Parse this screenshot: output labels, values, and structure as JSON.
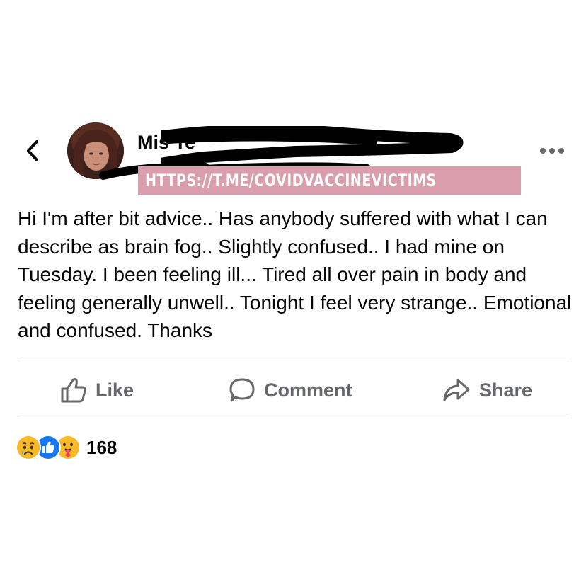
{
  "post": {
    "author_name": "Mis Te",
    "watermark": "HTTPS://T.ME/COVIDVACCINEVICTIMS",
    "text": "Hi I'm after bit advice.. Has anybody suffered with what I can describe as brain fog.. Slightly confused.. I had mine on Tuesday. I been feeling ill... Tired all over pain in body and feeling generally unwell.. Tonight I feel very strange.. Emotional and confused. Thanks"
  },
  "actions": {
    "like_label": "Like",
    "comment_label": "Comment",
    "share_label": "Share"
  },
  "reactions": {
    "icons": [
      "sad-reaction-icon",
      "like-reaction-icon",
      "care-reaction-icon"
    ],
    "count": "168"
  },
  "colors": {
    "text": "#050505",
    "secondary_text": "#65676b",
    "divider": "#d8dadf",
    "like_blue": "#1877f2",
    "reaction_yellow": "#f7b928",
    "watermark_bg": "#d99dab"
  }
}
